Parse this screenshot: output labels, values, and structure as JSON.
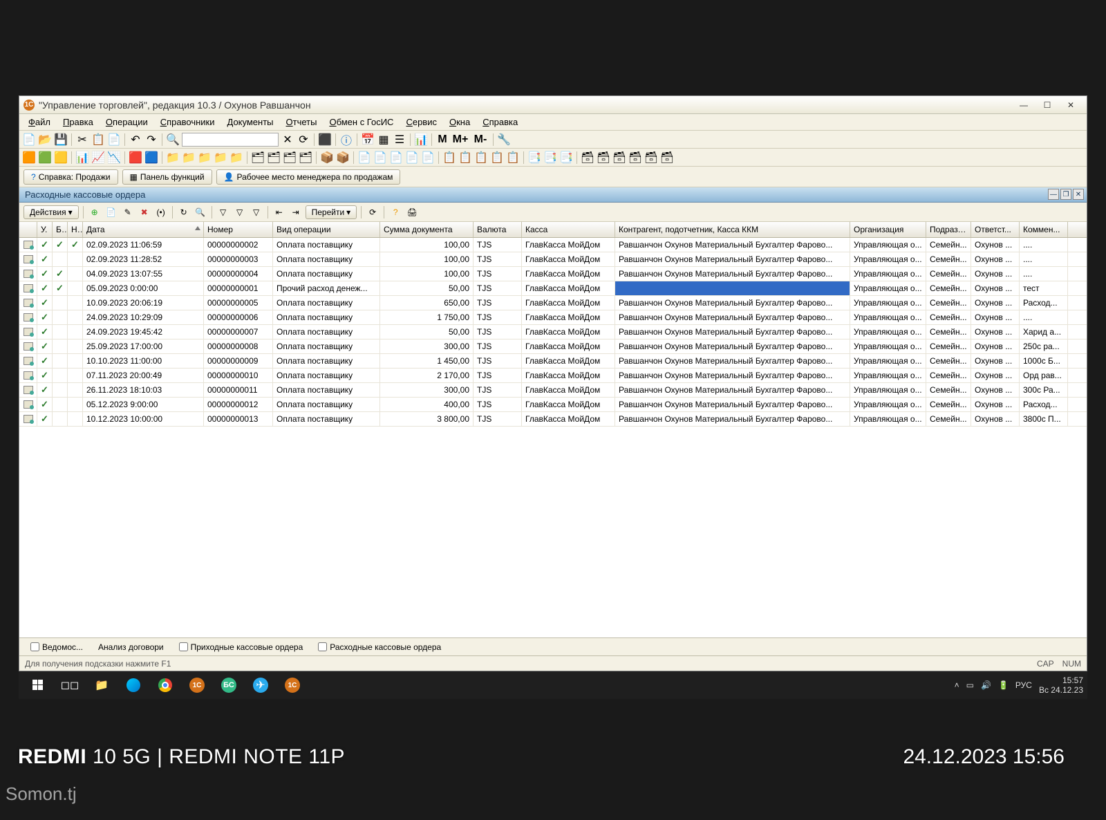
{
  "window": {
    "title": "\"Управление торговлей\", редакция 10.3 / Охунов Равшанчон"
  },
  "menu": {
    "items": [
      "Файл",
      "Правка",
      "Операции",
      "Справочники",
      "Документы",
      "Отчеты",
      "Обмен с ГосИС",
      "Сервис",
      "Окна",
      "Справка"
    ]
  },
  "toolbar2_labels": {
    "m": "M",
    "mplus": "M+",
    "mminus": "M-"
  },
  "panel": {
    "help": "Справка: Продажи",
    "functions": "Панель функций",
    "workplace": "Рабочее место менеджера по продажам"
  },
  "tab": {
    "title": "Расходные кассовые ордера"
  },
  "actionbar": {
    "actions": "Действия",
    "goto": "Перейти"
  },
  "grid": {
    "headers": {
      "c1": "У.",
      "c2": "Б.",
      "c3": "Н.",
      "date": "Дата",
      "number": "Номер",
      "optype": "Вид операции",
      "sum": "Сумма документа",
      "currency": "Валюта",
      "kassa": "Касса",
      "contractor": "Контрагент, подотчетник, Касса ККМ",
      "org": "Организация",
      "division": "Подразд...",
      "responsible": "Ответст...",
      "comment": "Коммен..."
    },
    "rows": [
      {
        "posted": true,
        "u": true,
        "b": true,
        "n": true,
        "date": "02.09.2023 11:06:59",
        "num": "00000000002",
        "op": "Оплата поставщику",
        "sum": "100,00",
        "cur": "TJS",
        "kassa": "ГлавКасса МойДом",
        "contr": "Равшанчон Охунов Материальный Бухгалтер Фарово...",
        "org": "Управляющая о...",
        "div": "Семейн...",
        "resp": "Охунов ...",
        "com": "...."
      },
      {
        "posted": true,
        "u": true,
        "b": false,
        "n": false,
        "date": "02.09.2023 11:28:52",
        "num": "00000000003",
        "op": "Оплата поставщику",
        "sum": "100,00",
        "cur": "TJS",
        "kassa": "ГлавКасса МойДом",
        "contr": "Равшанчон Охунов Материальный Бухгалтер Фарово...",
        "org": "Управляющая о...",
        "div": "Семейн...",
        "resp": "Охунов ...",
        "com": "...."
      },
      {
        "posted": true,
        "u": true,
        "b": true,
        "n": false,
        "date": "04.09.2023 13:07:55",
        "num": "00000000004",
        "op": "Оплата поставщику",
        "sum": "100,00",
        "cur": "TJS",
        "kassa": "ГлавКасса МойДом",
        "contr": "Равшанчон Охунов Материальный Бухгалтер Фарово...",
        "org": "Управляющая о...",
        "div": "Семейн...",
        "resp": "Охунов ...",
        "com": "...."
      },
      {
        "posted": true,
        "u": true,
        "b": true,
        "n": false,
        "date": "05.09.2023 0:00:00",
        "num": "00000000001",
        "op": "Прочий расход денеж...",
        "sum": "50,00",
        "cur": "TJS",
        "kassa": "ГлавКасса МойДом",
        "contr": "",
        "org": "Управляющая о...",
        "div": "Семейн...",
        "resp": "Охунов ...",
        "com": "тест",
        "selected": true
      },
      {
        "posted": true,
        "u": true,
        "b": false,
        "n": false,
        "date": "10.09.2023 20:06:19",
        "num": "00000000005",
        "op": "Оплата поставщику",
        "sum": "650,00",
        "cur": "TJS",
        "kassa": "ГлавКасса МойДом",
        "contr": "Равшанчон Охунов Материальный Бухгалтер Фарово...",
        "org": "Управляющая о...",
        "div": "Семейн...",
        "resp": "Охунов ...",
        "com": "Расход..."
      },
      {
        "posted": true,
        "u": true,
        "b": false,
        "n": false,
        "date": "24.09.2023 10:29:09",
        "num": "00000000006",
        "op": "Оплата поставщику",
        "sum": "1 750,00",
        "cur": "TJS",
        "kassa": "ГлавКасса МойДом",
        "contr": "Равшанчон Охунов Материальный Бухгалтер Фарово...",
        "org": "Управляющая о...",
        "div": "Семейн...",
        "resp": "Охунов ...",
        "com": "...."
      },
      {
        "posted": true,
        "u": true,
        "b": false,
        "n": false,
        "date": "24.09.2023 19:45:42",
        "num": "00000000007",
        "op": "Оплата поставщику",
        "sum": "50,00",
        "cur": "TJS",
        "kassa": "ГлавКасса МойДом",
        "contr": "Равшанчон Охунов Материальный Бухгалтер Фарово...",
        "org": "Управляющая о...",
        "div": "Семейн...",
        "resp": "Охунов ...",
        "com": "Харид а..."
      },
      {
        "posted": true,
        "u": true,
        "b": false,
        "n": false,
        "date": "25.09.2023 17:00:00",
        "num": "00000000008",
        "op": "Оплата поставщику",
        "sum": "300,00",
        "cur": "TJS",
        "kassa": "ГлавКасса МойДом",
        "contr": "Равшанчон Охунов Материальный Бухгалтер Фарово...",
        "org": "Управляющая о...",
        "div": "Семейн...",
        "resp": "Охунов ...",
        "com": "250с ра..."
      },
      {
        "posted": true,
        "u": true,
        "b": false,
        "n": false,
        "date": "10.10.2023 11:00:00",
        "num": "00000000009",
        "op": "Оплата поставщику",
        "sum": "1 450,00",
        "cur": "TJS",
        "kassa": "ГлавКасса МойДом",
        "contr": "Равшанчон Охунов Материальный Бухгалтер Фарово...",
        "org": "Управляющая о...",
        "div": "Семейн...",
        "resp": "Охунов ...",
        "com": "1000с Б..."
      },
      {
        "posted": true,
        "u": true,
        "b": false,
        "n": false,
        "date": "07.11.2023 20:00:49",
        "num": "00000000010",
        "op": "Оплата поставщику",
        "sum": "2 170,00",
        "cur": "TJS",
        "kassa": "ГлавКасса МойДом",
        "contr": "Равшанчон Охунов Материальный Бухгалтер Фарово...",
        "org": "Управляющая о...",
        "div": "Семейн...",
        "resp": "Охунов ...",
        "com": "Орд рав..."
      },
      {
        "posted": true,
        "u": true,
        "b": false,
        "n": false,
        "date": "26.11.2023 18:10:03",
        "num": "00000000011",
        "op": "Оплата поставщику",
        "sum": "300,00",
        "cur": "TJS",
        "kassa": "ГлавКасса МойДом",
        "contr": "Равшанчон Охунов Материальный Бухгалтер Фарово...",
        "org": "Управляющая о...",
        "div": "Семейн...",
        "resp": "Охунов ...",
        "com": "300с Ра..."
      },
      {
        "posted": true,
        "u": true,
        "b": false,
        "n": false,
        "date": "05.12.2023 9:00:00",
        "num": "00000000012",
        "op": "Оплата поставщику",
        "sum": "400,00",
        "cur": "TJS",
        "kassa": "ГлавКасса МойДом",
        "contr": "Равшанчон Охунов Материальный Бухгалтер Фарово...",
        "org": "Управляющая о...",
        "div": "Семейн...",
        "resp": "Охунов ...",
        "com": "Расход..."
      },
      {
        "posted": true,
        "u": true,
        "b": false,
        "n": false,
        "date": "10.12.2023 10:00:00",
        "num": "00000000013",
        "op": "Оплата поставщику",
        "sum": "3 800,00",
        "cur": "TJS",
        "kassa": "ГлавКасса МойДом",
        "contr": "Равшанчон Охунов Материальный Бухгалтер Фарово...",
        "org": "Управляющая о...",
        "div": "Семейн...",
        "resp": "Охунов ...",
        "com": "3800с П..."
      }
    ]
  },
  "bottomtabs": {
    "t1": "Ведомос...",
    "t2": "Анализ договори",
    "t3": "Приходные кассовые ордера",
    "t4": "Расходные кассовые ордера"
  },
  "status": {
    "hint": "Для получения подсказки нажмите F1",
    "cap": "CAP",
    "num": "NUM"
  },
  "taskbar": {
    "lang": "РУС",
    "time": "15:57",
    "date": "Вс 24.12.23"
  },
  "overlay": {
    "device": "REDMI 10 5G | REDMI NOTE 11P",
    "device_bold": "REDMI",
    "device_rest": " 10 5G | REDMI NOTE 11P",
    "timestamp": "24.12.2023  15:56",
    "site": "Somon.tj"
  }
}
